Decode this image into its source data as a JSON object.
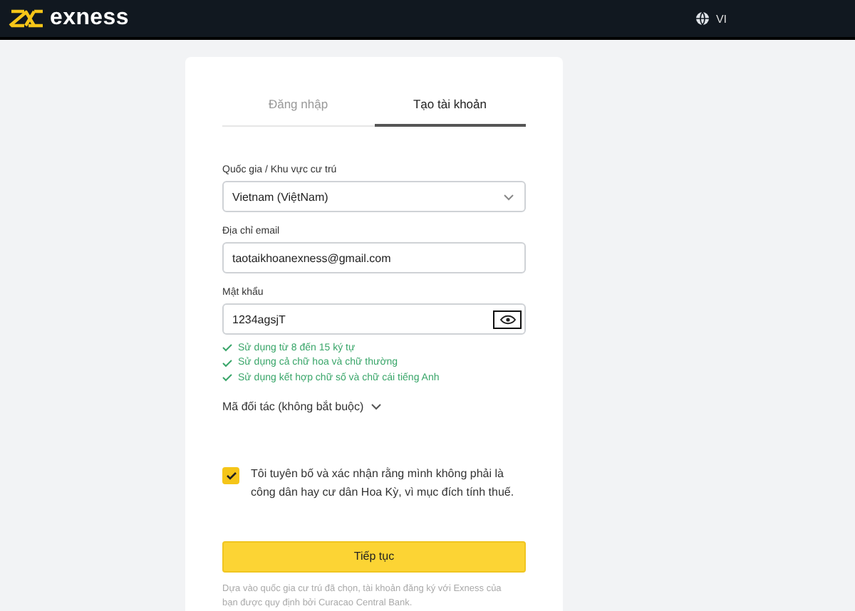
{
  "header": {
    "logo": "exness",
    "language": "VI"
  },
  "tabs": [
    {
      "label": "Đăng nhập",
      "selected": false
    },
    {
      "label": "Tạo tài khoản",
      "selected": true
    }
  ],
  "fields": [
    {
      "kind": "select",
      "label": "Quốc gia / Khu vực cư trú",
      "value": "Vietnam (ViệtNam)"
    },
    {
      "kind": "text",
      "label": "Địa chỉ email",
      "value": "taotaikhoanexness@gmail.com"
    },
    {
      "kind": "password",
      "label": "Mật khẩu",
      "value": "1234agsjT"
    }
  ],
  "password_rules": [
    {
      "text": "Sử dụng từ 8 đến 15 ký tự",
      "met": true
    },
    {
      "text": "Sử dụng cả chữ hoa và chữ thường",
      "met": true
    },
    {
      "text": "Sử dụng kết hợp chữ số và chữ cái tiếng Anh",
      "met": true
    }
  ],
  "partner_code": {
    "label": "Mã đối tác (không bắt buộc)",
    "expanded": false
  },
  "declaration": {
    "text": "Tôi tuyên bố và xác nhận rằng mình không phải là công dân hay cư dân Hoa Kỳ, vì mục đích tính thuế.",
    "checked": true
  },
  "submit": "Tiếp tục",
  "footnote": "Dựa vào quốc gia cư trú đã chọn, tài khoản đăng ký với Exness của bạn được quy định bởi Curacao Central Bank."
}
